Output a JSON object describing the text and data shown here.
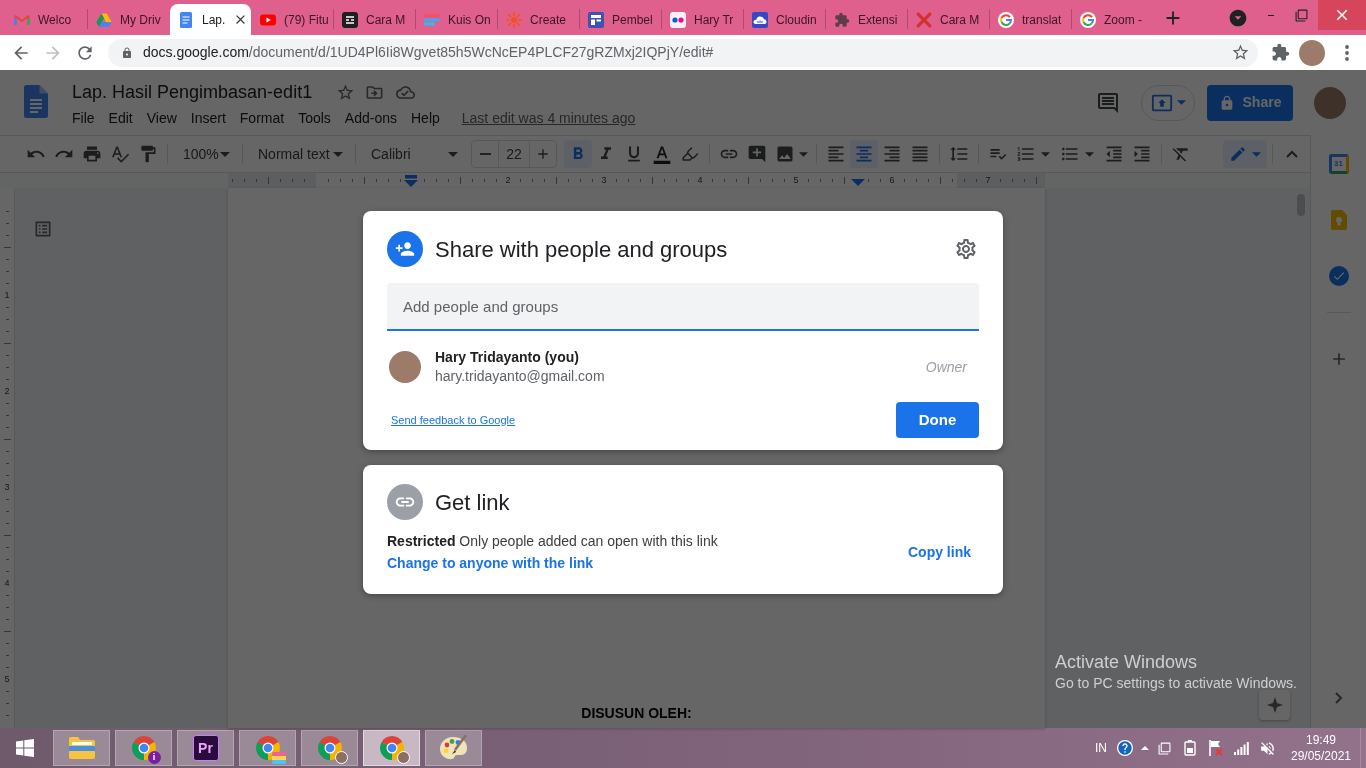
{
  "browser": {
    "tabs": [
      {
        "kind": "mail",
        "title": "Welco",
        "selected": false
      },
      {
        "kind": "drive",
        "title": "My Driv",
        "selected": false
      },
      {
        "kind": "doc",
        "title": "Lap.",
        "selected": true
      },
      {
        "kind": "video",
        "title": "(79) Fitu",
        "selected": false
      },
      {
        "kind": "notes",
        "title": "Cara M",
        "selected": false
      },
      {
        "kind": "quiz",
        "title": "Kuis On",
        "selected": false
      },
      {
        "kind": "sun",
        "title": "Create",
        "selected": false
      },
      {
        "kind": "layout",
        "title": "Pembel",
        "selected": false
      },
      {
        "kind": "dots",
        "title": "Hary Tr",
        "selected": false
      },
      {
        "kind": "cloud",
        "title": "Cloudin",
        "selected": false
      },
      {
        "kind": "puzzle",
        "title": "Extensi",
        "selected": false
      },
      {
        "kind": "cross",
        "title": "Cara M",
        "selected": false
      },
      {
        "kind": "google",
        "title": "translat",
        "selected": false
      },
      {
        "kind": "google",
        "title": "Zoom -",
        "selected": false
      }
    ],
    "forward_button": {
      "disabled": true
    },
    "address": {
      "host": "docs.google.com",
      "path": "/document/d/1UD4Pl6Ii8Wgvet85h5WcNcEP4PLCF27gRZMxj2IQPjY/edit#"
    }
  },
  "document": {
    "title": "Lap. Hasil Pengimbasan-edit1",
    "menu": [
      "File",
      "Edit",
      "View",
      "Insert",
      "Format",
      "Tools",
      "Add-ons",
      "Help"
    ],
    "last_edit": "Last edit was 4 minutes ago",
    "share_button": "Share",
    "toolbar": {
      "zoom": "100%",
      "paragraph_style": "Normal text",
      "font": "Calibri",
      "font_size": "22",
      "text_styles": [
        {
          "kind": "bold",
          "selected": true
        },
        {
          "kind": "italic",
          "selected": false
        },
        {
          "kind": "underline",
          "selected": false
        }
      ],
      "alignment": [
        {
          "kind": "left",
          "selected": false
        },
        {
          "kind": "center",
          "selected": true
        },
        {
          "kind": "right",
          "selected": false
        },
        {
          "kind": "justify",
          "selected": false
        }
      ]
    },
    "ruler_numbers": [
      "2",
      "3",
      "4",
      "5",
      "6",
      "7"
    ],
    "vertical_ruler_numbers": [
      "1",
      "2",
      "3",
      "4",
      "5"
    ],
    "page_text": "DISUSUN OLEH:",
    "side_panel": {
      "calendar_day": "31"
    }
  },
  "share_dialog": {
    "title": "Share with people and groups",
    "input": {
      "placeholder": "Add people and groups",
      "focused": true
    },
    "people": [
      {
        "name": "Hary Tridayanto (you)",
        "email": "hary.tridayanto@gmail.com",
        "role": "Owner"
      }
    ],
    "feedback_link": "Send feedback to Google",
    "done_button": "Done"
  },
  "link_panel": {
    "title": "Get link",
    "description": "**Restricted** Only people added can open with this link",
    "change_link": "Change to anyone with the link",
    "copy_link": "Copy link"
  },
  "windows_notice": {
    "title": "Activate Windows",
    "text": "Go to PC settings to activate Windows."
  },
  "taskbar": {
    "apps": [
      {
        "kind": "files",
        "selected": false
      },
      {
        "kind": "browser",
        "badge": {
          "kind": "letter",
          "text": "i"
        },
        "selected": false
      },
      {
        "kind": "editor",
        "label": "Pr",
        "selected": false
      },
      {
        "kind": "browser",
        "badge": {
          "kind": "stripes"
        },
        "selected": false
      },
      {
        "kind": "browser",
        "badge": {
          "kind": "photo"
        },
        "selected": false
      },
      {
        "kind": "browser",
        "badge": {
          "kind": "photo"
        },
        "selected": true
      },
      {
        "kind": "paint",
        "selected": false
      }
    ],
    "language": "IN",
    "time": "19:49",
    "date": "29/05/2021"
  }
}
